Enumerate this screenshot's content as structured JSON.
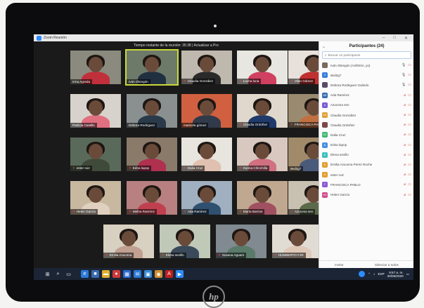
{
  "window": {
    "title": "Zoom Reunión"
  },
  "meeting": {
    "time_notice": "Tiempo restante de la reunión: 35:38 | Actualizar a Pro"
  },
  "participants_panel": {
    "title": "Participantes (24)",
    "search_placeholder": "Buscar un participante",
    "footer": {
      "invite_label": "Invitar",
      "mute_all_label": "Silenciar a todos"
    },
    "items": [
      {
        "name": "Iván Obregón (Anfitrión, yo)",
        "initials": "",
        "color": "#7a6a5a",
        "mic_on": true
      },
      {
        "name": "9ed2g7",
        "initials": "9",
        "color": "#3b7ddd",
        "mic_on": true
      },
      {
        "name": "Debora Rodriguez Galindo",
        "initials": "",
        "color": "#5a4a6a",
        "mic_on": true
      },
      {
        "name": "Ada Ramírez",
        "initials": "AR",
        "color": "#3a6fb0",
        "mic_on": false
      },
      {
        "name": "Azucena sen",
        "initials": "A",
        "color": "#7b5bd6",
        "mic_on": false
      },
      {
        "name": "Claudia González",
        "initials": "CG",
        "color": "#e0a030",
        "mic_on": false
      },
      {
        "name": "Claudia Ordoñez",
        "initials": "",
        "color": "#7a4a4a",
        "mic_on": false
      },
      {
        "name": "Dalia Cruz",
        "initials": "DC",
        "color": "#3cb870",
        "mic_on": false
      },
      {
        "name": "Edna lapop",
        "initials": "E",
        "color": "#4a8fe0",
        "mic_on": false
      },
      {
        "name": "Elena sevillo",
        "initials": "E",
        "color": "#3cc0c0",
        "mic_on": false
      },
      {
        "name": "Emilia Azucena Perez Roche",
        "initials": "E",
        "color": "#e0a030",
        "mic_on": false
      },
      {
        "name": "ester ruiz",
        "initials": "E",
        "color": "#e0a030",
        "mic_on": false
      },
      {
        "name": "FRANCISCA PABLO",
        "initials": "F",
        "color": "#8a5bd6",
        "mic_on": false
      },
      {
        "name": "Helen García",
        "initials": "HG",
        "color": "#d04a8a",
        "mic_on": false
      }
    ]
  },
  "gallery": [
    {
      "name": "Irma Agreda",
      "muted": false,
      "bg": "#8a8a7e",
      "shirt": "#c0303a",
      "active": false
    },
    {
      "name": "Iván Obregón",
      "muted": false,
      "bg": "#6d7a6a",
      "shirt": "#203040",
      "active": true
    },
    {
      "name": "Claudia González",
      "muted": true,
      "bg": "#bfb8ae",
      "shirt": "#2a2a2a",
      "active": false
    },
    {
      "name": "Lucha luna",
      "muted": true,
      "bg": "#e8e6e0",
      "shirt": "#d04060",
      "active": false
    },
    {
      "name": "Vilan Gámez",
      "muted": true,
      "bg": "#e8e0da",
      "shirt": "#c03030",
      "active": false
    },
    {
      "name": "Patricia Castillo",
      "muted": false,
      "bg": "#d8d2cc",
      "shirt": "#e07080",
      "active": false
    },
    {
      "name": "Debora Rodriguez",
      "muted": false,
      "bg": "#8a9090",
      "shirt": "#2a3a4a",
      "active": false
    },
    {
      "name": "maricela gómez",
      "muted": false,
      "bg": "#d06040",
      "shirt": "#303a4a",
      "active": false
    },
    {
      "name": "Claudia Ordoñez",
      "muted": true,
      "bg": "#e0d8cc",
      "shirt": "#203a6a",
      "active": false
    },
    {
      "name": "FRANCISCA PABLO",
      "muted": true,
      "bg": "#9a8a70",
      "shirt": "#c07040",
      "active": false
    },
    {
      "name": "ester ruiz",
      "muted": true,
      "bg": "#5a6a5a",
      "shirt": "#404a3a",
      "active": false
    },
    {
      "name": "Edna lapop",
      "muted": true,
      "bg": "#8a7a6a",
      "shirt": "#b03050",
      "active": false
    },
    {
      "name": "Dalia Cruz",
      "muted": true,
      "bg": "#e8e4de",
      "shirt": "#e0c0b0",
      "active": false
    },
    {
      "name": "Karina Chinchilla",
      "muted": true,
      "bg": "#d8c8c0",
      "shirt": "#d07080",
      "active": false
    },
    {
      "name": "9ed2g7",
      "muted": false,
      "bg": "#a08a6a",
      "shirt": "#4a5a7a",
      "active": false
    },
    {
      "name": "Helen García",
      "muted": true,
      "bg": "#c8b8a0",
      "shirt": "#e0d0c0",
      "active": false
    },
    {
      "name": "Melba Ramírez",
      "muted": true,
      "bg": "#b88080",
      "shirt": "#c04050",
      "active": false
    },
    {
      "name": "Ada Ramírez",
      "muted": true,
      "bg": "#a0b0c0",
      "shirt": "#305070",
      "active": false
    },
    {
      "name": "Marta Barrios",
      "muted": true,
      "bg": "#c0a890",
      "shirt": "#a05060",
      "active": false
    },
    {
      "name": "Azucena sen",
      "muted": true,
      "bg": "#c8c0b0",
      "shirt": "#5a6a4a",
      "active": false
    },
    {
      "name": "Emilia Azucena",
      "muted": true,
      "bg": "#d8d0c0",
      "shirt": "#c0a090",
      "active": false
    },
    {
      "name": "Elena sevillo",
      "muted": true,
      "bg": "#c0c8b8",
      "shirt": "#3a4a5a",
      "active": false
    },
    {
      "name": "Susana Aguare",
      "muted": true,
      "bg": "#808a90",
      "shirt": "#5a7a6a",
      "active": false
    },
    {
      "name": "HUMBERTO FJR",
      "muted": true,
      "bg": "#e0dcd4",
      "shirt": "#e0c8b8",
      "active": false
    }
  ],
  "taskbar": {
    "icons": [
      {
        "name": "windows-start-icon",
        "glyph": "⊞",
        "color": "#1b2535"
      },
      {
        "name": "search-icon",
        "glyph": "⌕",
        "color": "#1b2535"
      },
      {
        "name": "task-view-icon",
        "glyph": "▭",
        "color": "#1b2535"
      },
      {
        "name": "edge-icon",
        "glyph": "e",
        "color": "#2a7ad8"
      },
      {
        "name": "store-icon",
        "glyph": "■",
        "color": "#3a6ab0"
      },
      {
        "name": "file-explorer-icon",
        "glyph": "▬",
        "color": "#e0b030"
      },
      {
        "name": "media-icon",
        "glyph": "●",
        "color": "#d03a3a"
      },
      {
        "name": "calendar-icon",
        "glyph": "▦",
        "color": "#2a6ad0"
      },
      {
        "name": "mail-icon",
        "glyph": "✉",
        "color": "#2a7ad8"
      },
      {
        "name": "photos-icon",
        "glyph": "▣",
        "color": "#3a8ad0"
      },
      {
        "name": "chrome-icon",
        "glyph": "◉",
        "color": "#d09030"
      },
      {
        "name": "acrobat-icon",
        "glyph": "A",
        "color": "#c02020"
      },
      {
        "name": "zoom-app-icon",
        "glyph": "▶",
        "color": "#2d8cff"
      }
    ],
    "time": "9:57 a. m.",
    "date": "30/05/2020"
  }
}
